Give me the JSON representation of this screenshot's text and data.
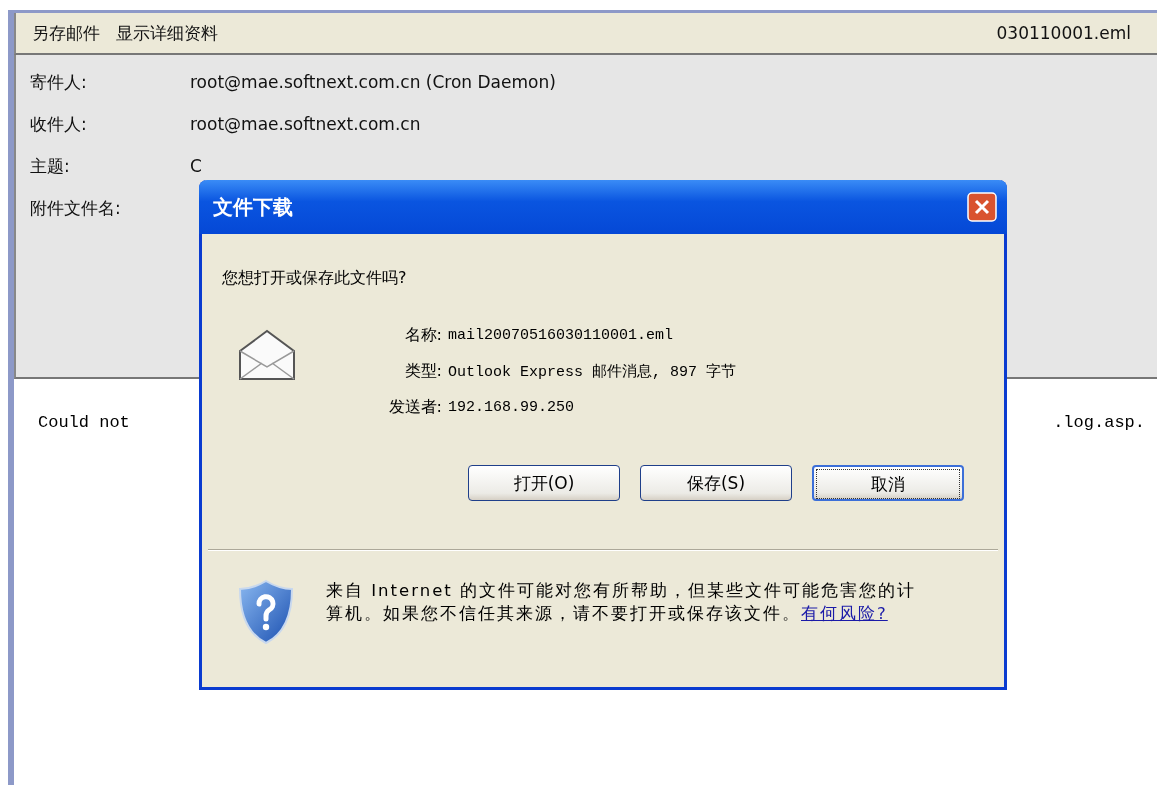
{
  "toolbar": {
    "actions": [
      "另存邮件",
      "显示详细资料"
    ],
    "filename": "030110001.eml"
  },
  "headers": [
    {
      "label": "寄件人:",
      "value": "root@mae.softnext.com.cn (Cron Daemon)"
    },
    {
      "label": "收件人:",
      "value": "root@mae.softnext.com.cn"
    },
    {
      "label": "主题:",
      "value": "C"
    },
    {
      "label": "附件文件名:"
    }
  ],
  "body": {
    "left": "Could not",
    "right": ".log.asp."
  },
  "dialog": {
    "title": "文件下载",
    "question": "您想打开或保存此文件吗?",
    "fields": [
      {
        "label": "名称:",
        "value": "mail20070516030110001.eml"
      },
      {
        "label": "类型:",
        "value": "Outlook Express 邮件消息, 897 字节"
      },
      {
        "label": "发送者:",
        "value": "192.168.99.250"
      }
    ],
    "buttons": [
      {
        "label": "打开(O)",
        "default": false
      },
      {
        "label": "保存(S)",
        "default": false
      },
      {
        "label": "取消",
        "default": true
      }
    ],
    "warning": "来自 Internet 的文件可能对您有所帮助，但某些文件可能危害您的计算机。如果您不信任其来源，请不要打开或保存该文件。",
    "link": "有何风险?"
  }
}
